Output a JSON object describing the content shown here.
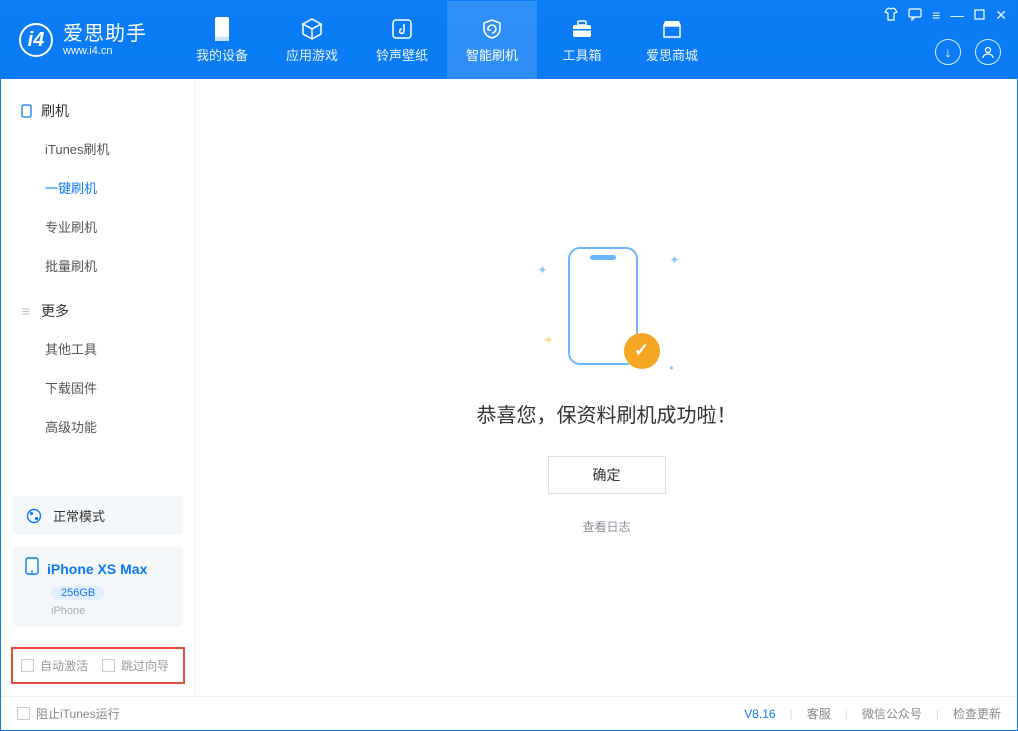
{
  "app": {
    "title": "爱思助手",
    "subtitle": "www.i4.cn"
  },
  "nav": {
    "items": [
      {
        "label": "我的设备"
      },
      {
        "label": "应用游戏"
      },
      {
        "label": "铃声壁纸"
      },
      {
        "label": "智能刷机"
      },
      {
        "label": "工具箱"
      },
      {
        "label": "爱思商城"
      }
    ],
    "active_index": 3
  },
  "sidebar": {
    "group1": {
      "title": "刷机",
      "items": [
        "iTunes刷机",
        "一键刷机",
        "专业刷机",
        "批量刷机"
      ],
      "active_index": 1
    },
    "group2": {
      "title": "更多",
      "items": [
        "其他工具",
        "下载固件",
        "高级功能"
      ]
    },
    "mode": "正常模式",
    "device": {
      "name": "iPhone XS Max",
      "storage": "256GB",
      "type": "iPhone"
    },
    "checks": {
      "auto_activate": "自动激活",
      "skip_guide": "跳过向导"
    }
  },
  "main": {
    "success_text": "恭喜您，保资料刷机成功啦！",
    "ok": "确定",
    "view_log": "查看日志"
  },
  "footer": {
    "block_itunes": "阻止iTunes运行",
    "version": "V8.16",
    "links": [
      "客服",
      "微信公众号",
      "检查更新"
    ]
  }
}
